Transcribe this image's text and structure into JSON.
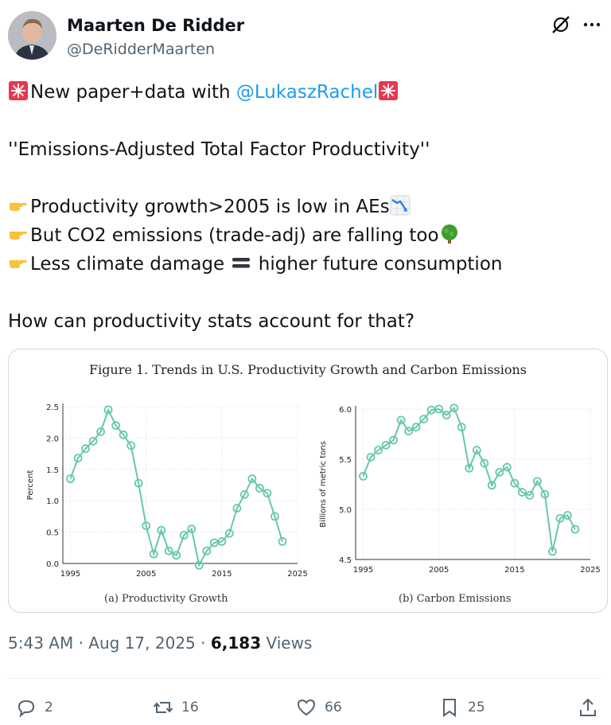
{
  "author": {
    "name": "Maarten De Ridder",
    "handle": "@DeRidderMaarten"
  },
  "tweet": {
    "line1_text": "New paper+data with ",
    "line1_mention": "@LukaszRachel",
    "line2": "''Emissions-Adjusted Total Factor Productivity''",
    "bullet1": "Productivity growth>2005 is low in AEs",
    "bullet2": "But CO2 emissions (trade-adj) are falling too",
    "bullet3_a": "Less climate damage ",
    "bullet3_b": " higher future consumption",
    "closing": "How can productivity stats account for that?"
  },
  "icons": {
    "header": [
      "grok-icon",
      "more-icon"
    ],
    "emoji": [
      "rotating-light-icon",
      "pointing-hand-icon",
      "chart-decreasing-icon",
      "deciduous-tree-icon",
      "heavy-equals-icon"
    ],
    "actions": [
      "reply-icon",
      "retweet-icon",
      "like-icon",
      "bookmark-icon",
      "share-icon"
    ]
  },
  "figure": {
    "title": "Figure 1. Trends in U.S. Productivity Growth and Carbon Emissions",
    "caption_a": "(a)  Productivity Growth",
    "caption_b": "(b)  Carbon Emissions"
  },
  "chart_data": [
    {
      "type": "line",
      "title": "",
      "xlabel": "",
      "ylabel": "Percent",
      "xlim": [
        1994,
        2025
      ],
      "ylim": [
        0,
        2.5
      ],
      "xticks": [
        1995,
        2005,
        2015,
        2025
      ],
      "yticks": [
        0.0,
        0.5,
        1.0,
        1.5,
        2.0,
        2.5
      ],
      "ytick_labels": [
        "0.0",
        "0.5",
        "1.0",
        "1.5",
        "2.0",
        "2.5"
      ],
      "grid": true,
      "color": "#66c9a7",
      "x": [
        1995,
        1996,
        1997,
        1998,
        1999,
        2000,
        2001,
        2002,
        2003,
        2004,
        2005,
        2006,
        2007,
        2008,
        2009,
        2010,
        2011,
        2012,
        2013,
        2014,
        2015,
        2016,
        2017,
        2018,
        2019,
        2020,
        2021,
        2022,
        2023
      ],
      "y": [
        1.35,
        1.68,
        1.83,
        1.95,
        2.1,
        2.45,
        2.2,
        2.05,
        1.88,
        1.28,
        0.6,
        0.15,
        0.53,
        0.2,
        0.13,
        0.45,
        0.55,
        -0.03,
        0.2,
        0.33,
        0.35,
        0.48,
        0.88,
        1.1,
        1.35,
        1.2,
        1.12,
        0.75,
        0.35
      ]
    },
    {
      "type": "line",
      "title": "",
      "xlabel": "",
      "ylabel": "Billions of metric tons",
      "xlim": [
        1994,
        2025
      ],
      "ylim": [
        4.5,
        6.0
      ],
      "xticks": [
        1995,
        2005,
        2015,
        2025
      ],
      "yticks": [
        4.5,
        5.0,
        5.5,
        6.0
      ],
      "ytick_labels": [
        "4.5",
        "5.0",
        "5.5",
        "6.0"
      ],
      "grid": true,
      "color": "#66c9a7",
      "x": [
        1995,
        1996,
        1997,
        1998,
        1999,
        2000,
        2001,
        2002,
        2003,
        2004,
        2005,
        2006,
        2007,
        2008,
        2009,
        2010,
        2011,
        2012,
        2013,
        2014,
        2015,
        2016,
        2017,
        2018,
        2019,
        2020,
        2021,
        2022,
        2023
      ],
      "y": [
        5.33,
        5.52,
        5.59,
        5.64,
        5.69,
        5.89,
        5.78,
        5.82,
        5.9,
        5.99,
        6.0,
        5.94,
        6.01,
        5.82,
        5.41,
        5.59,
        5.46,
        5.24,
        5.37,
        5.42,
        5.26,
        5.17,
        5.14,
        5.28,
        5.15,
        4.58,
        4.91,
        4.94,
        4.8
      ]
    }
  ],
  "meta": {
    "time": "5:43 AM",
    "date": "Aug 17, 2025",
    "views_count": "6,183",
    "views_label": "Views",
    "sep": " · "
  },
  "actions": {
    "replies": "2",
    "retweets": "16",
    "likes": "66",
    "bookmarks": "25"
  }
}
